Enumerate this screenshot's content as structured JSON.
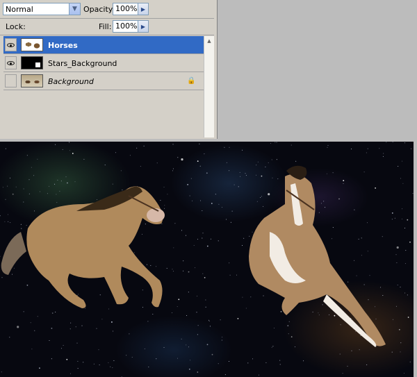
{
  "layers_panel": {
    "blend_mode": "Normal",
    "opacity_label": "Opacity:",
    "opacity_value": "100%",
    "lock_label": "Lock:",
    "fill_label": "Fill:",
    "fill_value": "100%",
    "layers": [
      {
        "name": "Horses",
        "visible": true,
        "selected": true,
        "style": "bold"
      },
      {
        "name": "Stars_Background",
        "visible": true,
        "selected": false,
        "style": "normal"
      },
      {
        "name": "Background",
        "visible": false,
        "selected": false,
        "style": "italic",
        "locked": true
      }
    ]
  },
  "colors": {
    "selection": "#316ac5",
    "panel": "#d4d0c8",
    "workspace": "#bcbcbc",
    "space": "#070810"
  },
  "icons": [
    "dropdown-arrow-icon",
    "flyout-arrow-icon",
    "lock-transparent-icon",
    "brush-icon",
    "move-icon",
    "padlock-icon",
    "eye-icon"
  ]
}
